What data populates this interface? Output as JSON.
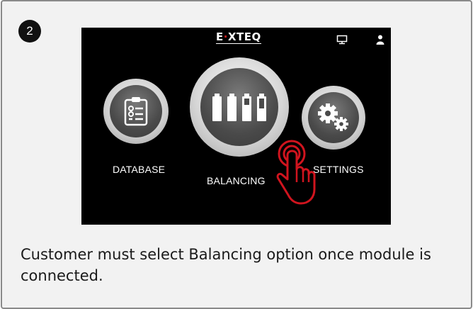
{
  "step": {
    "number": "2"
  },
  "device_screen": {
    "logo_text": "E·XTEQ",
    "logo_parts": {
      "left": "E",
      "dot": "·",
      "right": "XTEQ"
    },
    "status_icons": [
      "monitor-icon",
      "user-icon"
    ],
    "menu": {
      "database_label": "DATABASE",
      "balancing_label": "BALANCING",
      "settings_label": "SETTINGS"
    },
    "colors": {
      "screen_bg": "#000000",
      "highlight_red": "#d0141e"
    }
  },
  "caption": "Customer must select Balancing option once module is connected."
}
